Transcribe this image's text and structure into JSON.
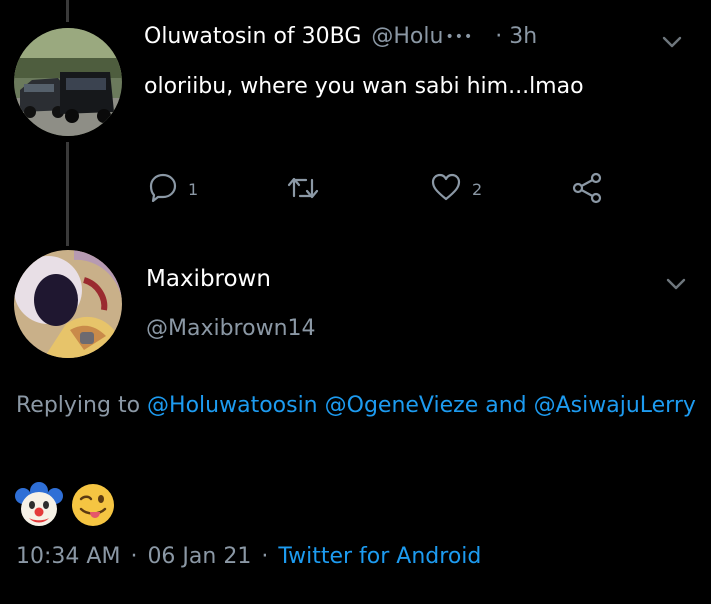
{
  "reply_tweet": {
    "display_name": "Oluwatosin of 30BG",
    "handle": "@Holu",
    "handle_ellipsis": "•••",
    "time": "· 3h",
    "text": "oloriibu, where you wan sabi him...lmao",
    "reply_count": "1",
    "retweet_count": "",
    "like_count": "2"
  },
  "main_tweet": {
    "display_name": "Maxibrown",
    "handle": "@Maxibrown14",
    "replying_prefix": "Replying to",
    "mention_1": "@Holuwatoosin",
    "mention_2": "@OgeneVieze",
    "and_text": "and",
    "mention_3": "@AsiwajuLerry",
    "emoji_1": "🤡",
    "emoji_2": "😜",
    "time": "10:34 AM",
    "dot": "·",
    "date": "06 Jan 21",
    "dot2": "·",
    "client": "Twitter for Android"
  },
  "colors": {
    "background": "#000000",
    "secondary_text": "#8b98a5",
    "link": "#1d9bf0"
  }
}
